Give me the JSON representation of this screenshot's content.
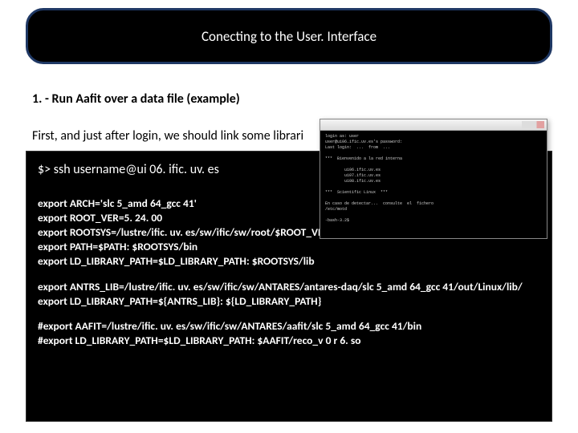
{
  "title": "Conecting to the User. Interface",
  "section_heading": "1. -  Run Aafit over a data file (example)",
  "intro": "First, and just after login, we should link some librari",
  "code": {
    "ssh": "$> ssh username@ui 06. ific. uv. es",
    "lines1": [
      "export ARCH='slc 5_amd 64_gcc 41'",
      "export ROOT_VER=5. 24. 00",
      "export ROOTSYS=/lustre/ific. uv. es/sw/ific/sw/root/$ROOT_VER/$ARCH/root/",
      "export PATH=$PATH: $ROOTSYS/bin",
      "export LD_LIBRARY_PATH=$LD_LIBRARY_PATH: $ROOTSYS/lib"
    ],
    "lines2": [
      "export ANTRS_LIB=/lustre/ific. uv. es/sw/ific/sw/ANTARES/antares-daq/slc 5_amd 64_gcc 41/out/Linux/lib/",
      "export LD_LIBRARY_PATH=${ANTRS_LIB}: ${LD_LIBRARY_PATH}"
    ],
    "lines3": [
      "#export AAFIT=/lustre/ific. uv. es/sw/ific/sw/ANTARES/aafit/slc 5_amd 64_gcc 41/bin",
      "#export LD_LIBRARY_PATH=$LD_LIBRARY_PATH: $AAFIT/reco_v 0 r 6. so"
    ]
  },
  "terminal": {
    "t1": "login as: user",
    "t2": "user@ui06.ific.uv.es's password:",
    "t3": "Last login:  ...  from  ...",
    "t4": "***  Bienvenido a la red interna",
    "t5": "        ui06.ific.uv.es",
    "t6": "        ui07.ific.uv.es",
    "t7": "        ui08.ific.uv.es",
    "t8": "***  Scientific Linux  ***",
    "t9": "En caso de detectar...  consulte  el  fichero",
    "t10": "/etc/motd",
    "t11": "-bash-3.2$"
  }
}
